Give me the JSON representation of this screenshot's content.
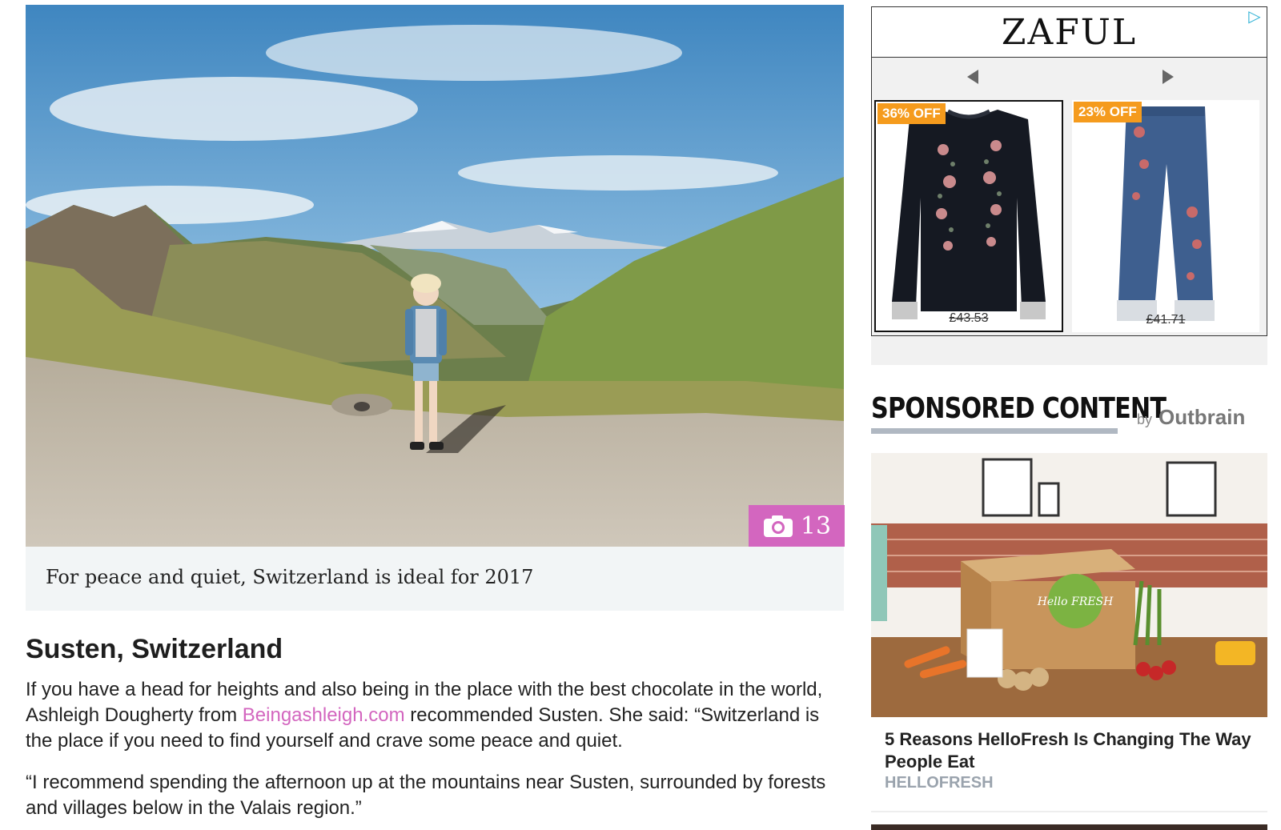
{
  "hero": {
    "image_alt": "Woman standing on a gravel mountain path in front of green alpine valleys and snowy peaks",
    "gallery_count": "13",
    "caption": "For peace and quiet, Switzerland is ideal for 2017"
  },
  "article": {
    "heading": "Susten, Switzerland",
    "p1_before": "If you have a head for heights and also being in the place with the best chocolate in the world, Ashleigh Dougherty from ",
    "p1_link": "Beingashleigh.com",
    "p1_after": " recommended Susten. She said: “Switzerland is the place if you need to find yourself and crave some peace and quiet.",
    "p2": "“I recommend spending the afternoon up at the mountains near Susten, surrounded by forests and villages below in the Valais region.”"
  },
  "ad": {
    "brand": "ZAFUL",
    "products": [
      {
        "discount": "36% OFF",
        "price": "£43.53",
        "name": "embroidered black sweatshirt"
      },
      {
        "discount": "23% OFF",
        "price": "£41.71",
        "name": "embroidered denim jeans"
      }
    ]
  },
  "sponsored": {
    "heading": "SPONSORED CONTENT",
    "by": "by",
    "provider": "Outbrain",
    "item_title": "5 Reasons HelloFresh Is Changing The Way People Eat",
    "item_source": "HELLOFRESH",
    "box_label": "Hello FRESH"
  },
  "colors": {
    "accent_pink": "#d366bf",
    "badge_orange": "#f59b1d",
    "caption_bg": "#f2f5f6"
  }
}
